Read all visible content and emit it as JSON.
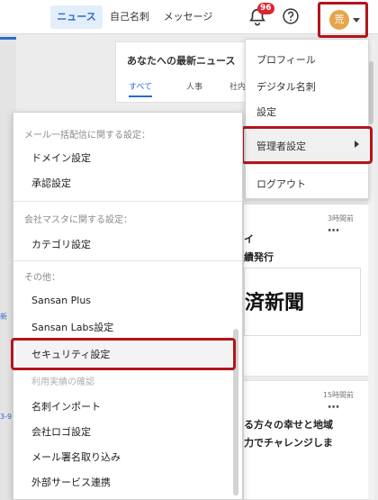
{
  "header": {
    "tabs": [
      {
        "label": "ニュース",
        "active": true
      },
      {
        "label": "自己名刺",
        "active": false
      },
      {
        "label": "メッセージ",
        "active": false
      }
    ],
    "notification_count": "96",
    "avatar_initial": "荒",
    "icons": [
      "bell-icon",
      "help-circle-icon",
      "chevron-down-icon"
    ],
    "accent_color": "#2a6bd1",
    "highlight_color": "#b3151b"
  },
  "news": {
    "title": "あなたへの最新ニュース",
    "filters": [
      "すべて",
      "人事",
      "社内"
    ],
    "cards": [
      {
        "time": "3時間前",
        "line1": "イ",
        "line2": "績発行",
        "paper": "済新聞"
      },
      {
        "time": "15時間前",
        "line1": "る方々の幸せと地域",
        "line2": "力でチャレンジしま"
      }
    ],
    "left_fragments": [
      "新",
      "3-9"
    ]
  },
  "profile_menu": {
    "items": [
      {
        "label": "プロフィール"
      },
      {
        "label": "デジタル名刺"
      },
      {
        "label": "設定"
      },
      {
        "label": "管理者設定",
        "has_submenu": true,
        "highlighted": true
      },
      {
        "label": "ログアウト"
      }
    ]
  },
  "admin_menu": {
    "sections": [
      {
        "heading": "メール一括配信に関する設定：",
        "items": [
          {
            "label": "ドメイン設定"
          },
          {
            "label": "承認設定"
          }
        ]
      },
      {
        "heading": "会社マスタに関する設定：",
        "items": [
          {
            "label": "カテゴリ設定"
          }
        ]
      },
      {
        "heading": "その他：",
        "items": [
          {
            "label": "Sansan Plus"
          },
          {
            "label": "Sansan Labs設定"
          },
          {
            "label": "セキュリティ設定",
            "highlighted": true
          },
          {
            "label": "利用実績の確認",
            "disabled": true
          },
          {
            "label": "名刺インポート"
          },
          {
            "label": "会社ロゴ設定"
          },
          {
            "label": "メール署名取り込み"
          },
          {
            "label": "外部サービス連携"
          }
        ]
      }
    ]
  }
}
